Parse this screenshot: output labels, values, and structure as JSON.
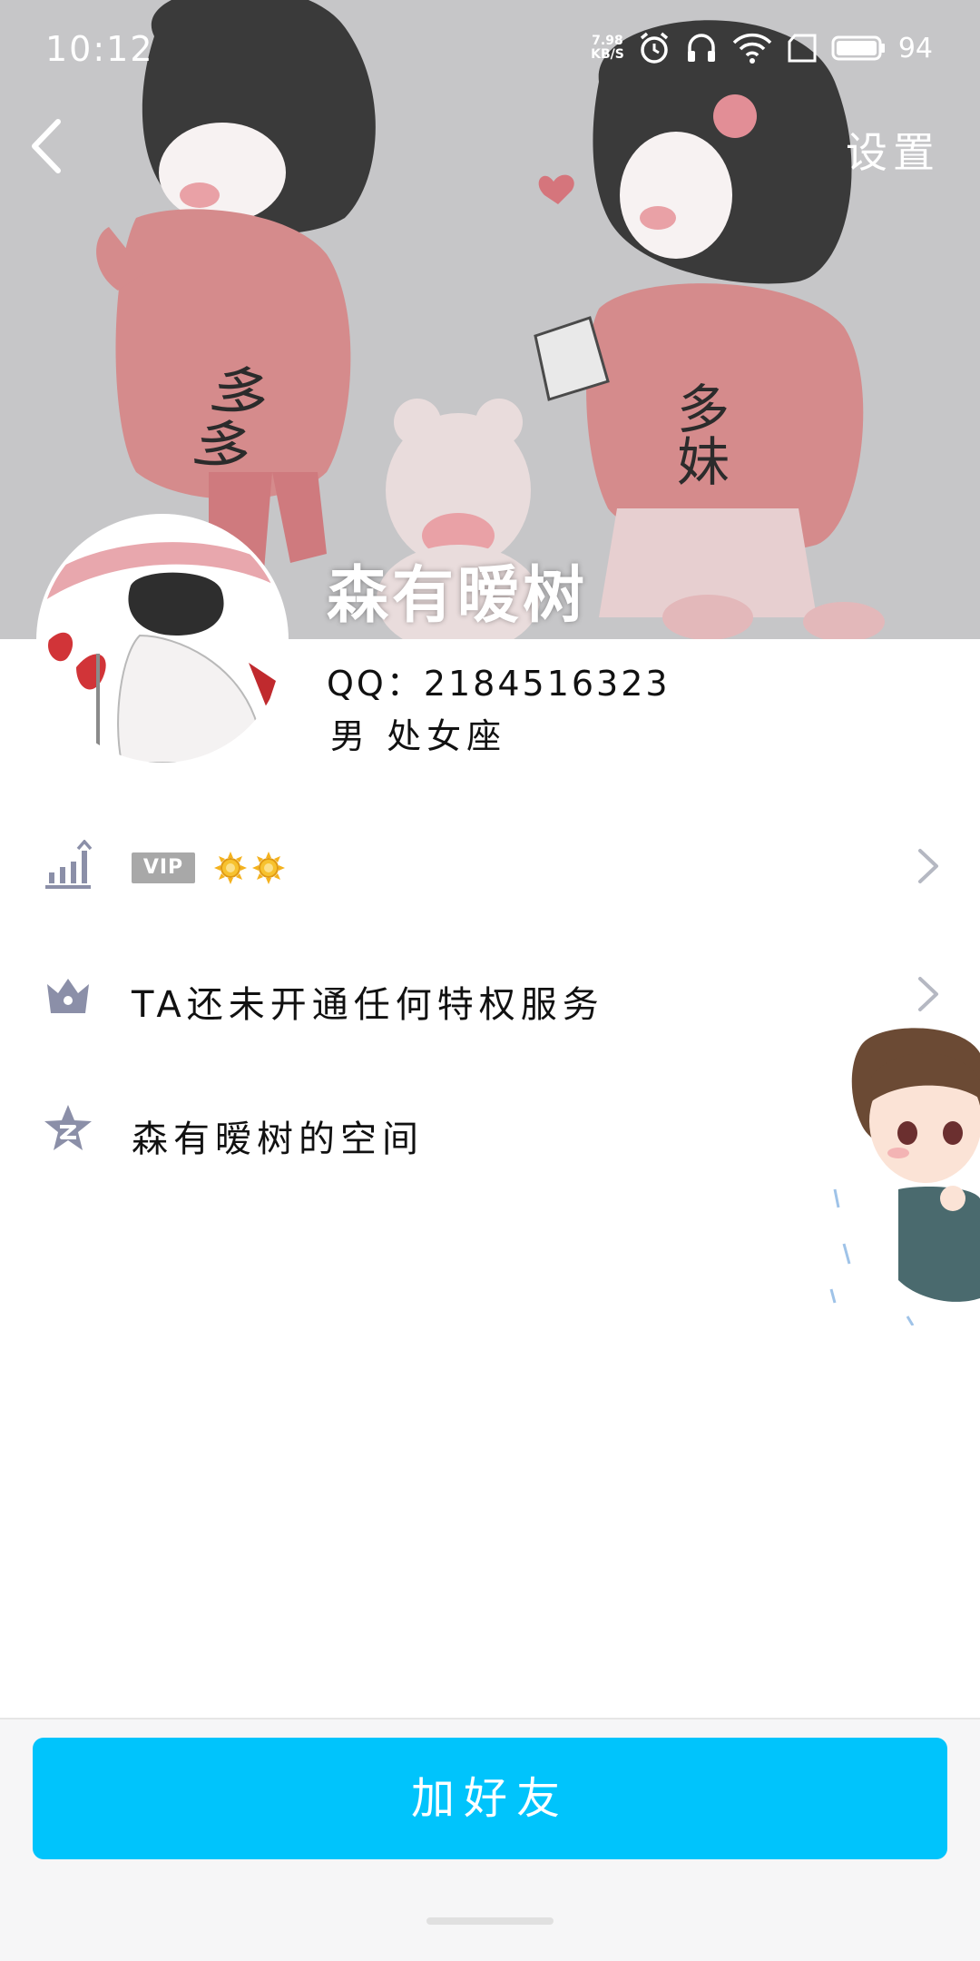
{
  "status_bar": {
    "time": "10:12",
    "net_speed_value": "7.98",
    "net_speed_unit": "KB/S",
    "battery": "94",
    "icons": [
      "alarm-icon",
      "headset-icon",
      "wifi-icon",
      "sim-icon",
      "battery-icon"
    ]
  },
  "nav": {
    "settings_label": "设置"
  },
  "cover": {
    "shirt_text_left": "多多",
    "shirt_text_right": "多妹"
  },
  "profile": {
    "nickname": "森有暧树",
    "qq": "QQ：2184516323",
    "gender_zodiac": "男 处女座"
  },
  "rows": {
    "vip": {
      "badge": "VIP",
      "level_icons": [
        "sun-icon",
        "sun-icon"
      ]
    },
    "privilege": {
      "label": "TA还未开通任何特权服务"
    },
    "qzone": {
      "label": "森有暧树的空间"
    }
  },
  "bottom": {
    "add_friend_label": "加好友"
  },
  "colors": {
    "accent": "#00c4fc",
    "icon_gray": "#8b8fa8"
  }
}
